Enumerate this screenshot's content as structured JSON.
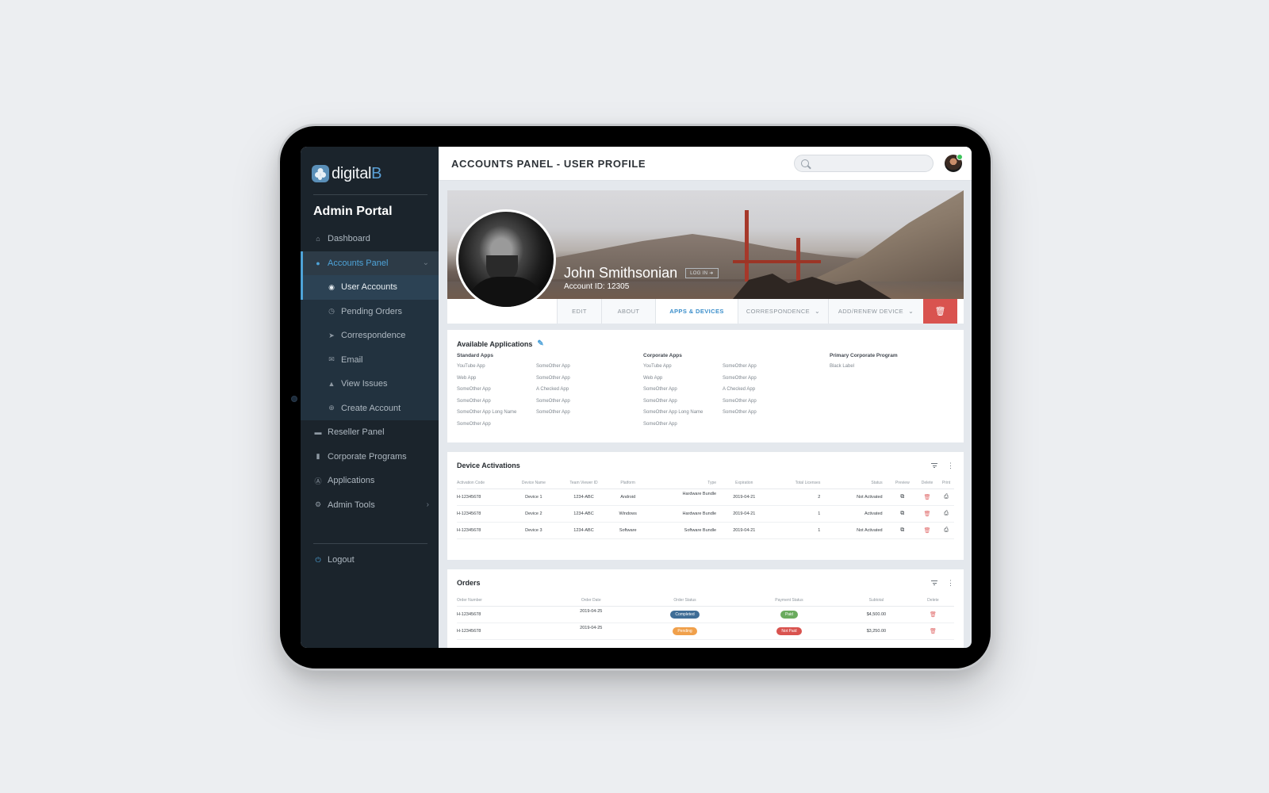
{
  "sidebar": {
    "logo_text_main": "digital",
    "logo_text_accent": "B",
    "portal_title": "Admin Portal",
    "items": [
      {
        "label": "Dashboard",
        "icon": "home-icon"
      },
      {
        "label": "Accounts Panel",
        "icon": "users-icon"
      },
      {
        "label": "Reseller Panel",
        "icon": "handshake-icon"
      },
      {
        "label": "Corporate Programs",
        "icon": "building-icon"
      },
      {
        "label": "Applications",
        "icon": "app-store-icon"
      },
      {
        "label": "Admin Tools",
        "icon": "cogs-icon"
      }
    ],
    "sub_items": [
      {
        "label": "User Accounts",
        "icon": "user-circle-icon"
      },
      {
        "label": "Pending Orders",
        "icon": "clock-icon"
      },
      {
        "label": "Correspondence",
        "icon": "paper-plane-icon"
      },
      {
        "label": "Email",
        "icon": "envelope-icon"
      },
      {
        "label": "View Issues",
        "icon": "warning-icon"
      },
      {
        "label": "Create Account",
        "icon": "plus-circle-icon"
      }
    ],
    "logout_label": "Logout"
  },
  "header": {
    "title": "ACCOUNTS PANEL - USER PROFILE",
    "search_placeholder": ""
  },
  "profile": {
    "name": "John Smithsonian",
    "login_label": "LOG IN",
    "account_id": "Account ID: 12305",
    "tabs": [
      {
        "label": "EDIT",
        "active": false
      },
      {
        "label": "ABOUT",
        "active": false
      },
      {
        "label": "APPS & DEVICES",
        "active": true
      },
      {
        "label": "CORRESPONDENCE",
        "active": false,
        "dropdown": true
      },
      {
        "label": "ADD/RENEW DEVICE",
        "active": false,
        "dropdown": true
      }
    ]
  },
  "applications": {
    "title": "Available Applications",
    "standard": {
      "heading": "Standard Apps",
      "col1": [
        "YouTube App",
        "Web App",
        "SomeOther App",
        "SomeOther App",
        "SomeOther App Long Name",
        "SomeOther App"
      ],
      "col2": [
        "SomeOther App",
        "SomeOther App",
        "A Checked App",
        "SomeOther App",
        "SomeOther App"
      ]
    },
    "corporate": {
      "heading": "Corporate Apps",
      "col1": [
        "YouTube App",
        "Web App",
        "SomeOther App",
        "SomeOther App",
        "SomeOther App Long Name",
        "SomeOther App"
      ],
      "col2": [
        "SomeOther App",
        "SomeOther App",
        "A Checked App",
        "SomeOther App",
        "SomeOther App"
      ]
    },
    "primary": {
      "heading": "Primary Corporate Program",
      "items": [
        "Black Label"
      ]
    }
  },
  "devices": {
    "title": "Device Activations",
    "columns": [
      "Activation Code",
      "Device Name",
      "Team Viewer ID",
      "Platform",
      "Type",
      "Expiration",
      "Total Licenses",
      "Status",
      "Preview",
      "Delete",
      "Print"
    ],
    "rows": [
      {
        "code": "H-12345678",
        "name": "Device 1",
        "tvid": "1234-ABC",
        "platform": "Android",
        "type": "Hardware Bundle",
        "expiration": "2019-04-21",
        "licenses": "2",
        "status": "Not Activated"
      },
      {
        "code": "H-12345678",
        "name": "Device 2",
        "tvid": "1234-ABC",
        "platform": "Windows",
        "type": "Hardware Bundle",
        "expiration": "2019-04-21",
        "licenses": "1",
        "status": "Activated"
      },
      {
        "code": "H-12345678",
        "name": "Device 3",
        "tvid": "1234-ABC",
        "platform": "Software",
        "type": "Software Bundle",
        "expiration": "2019-04-21",
        "licenses": "1",
        "status": "Not Activated"
      }
    ]
  },
  "orders": {
    "title": "Orders",
    "columns": [
      "Order Number",
      "Order Date",
      "Order Status",
      "Payment Status",
      "Subtotal",
      "Delete"
    ],
    "rows": [
      {
        "number": "H-12345678",
        "date": "2019-04-25",
        "status": "Completed",
        "status_color": "#3f6d96",
        "payment": "Paid",
        "payment_color": "#6aab5e",
        "subtotal": "$4,500.00"
      },
      {
        "number": "H-12345678",
        "date": "2019-04-25",
        "status": "Pending",
        "status_color": "#f0a04b",
        "payment": "Not Paid",
        "payment_color": "#d9534f",
        "subtotal": "$3,250.00"
      }
    ]
  },
  "colors": {
    "accent": "#4ea3d8",
    "sidebar_bg": "#1b242c",
    "danger": "#d9534f",
    "success": "#6aab5e"
  }
}
